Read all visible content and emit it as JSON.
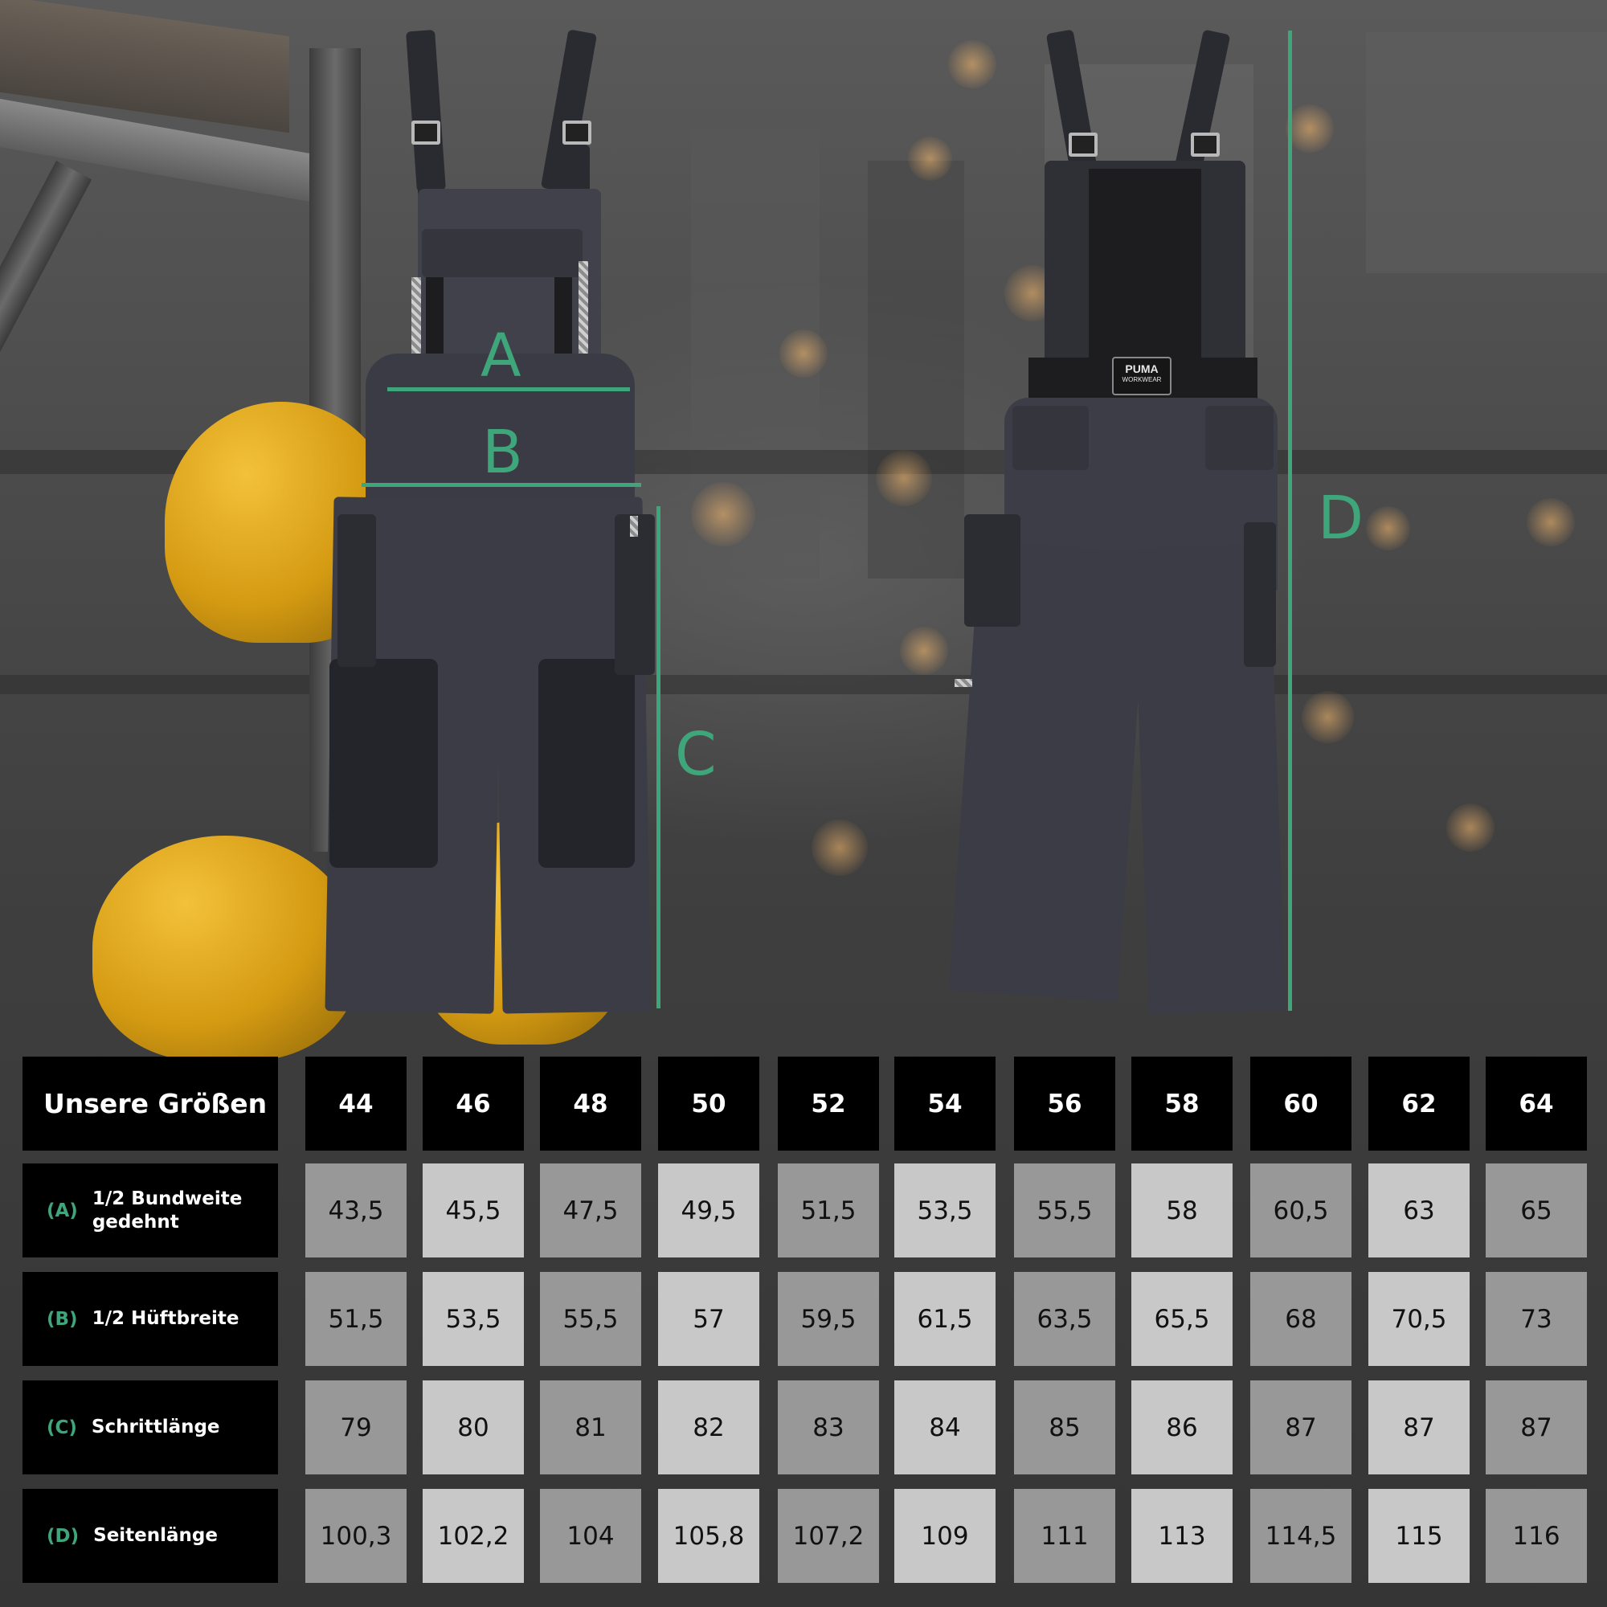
{
  "measure_letters": {
    "a": "A",
    "b": "B",
    "c": "C",
    "d": "D"
  },
  "brand_badge": {
    "line1": "PUMA",
    "line2": "WORKWEAR"
  },
  "colors": {
    "accent": "#3fa57a",
    "header_bg": "#000000",
    "cell_light": "#c8c8c8",
    "cell_dark": "#989898"
  },
  "size_table": {
    "title": "Unsere Größen",
    "sizes": [
      "44",
      "46",
      "48",
      "50",
      "52",
      "54",
      "56",
      "58",
      "60",
      "62",
      "64"
    ],
    "rows": [
      {
        "letter": "(A)",
        "label": "1/2 Bundweite gedehnt",
        "values": [
          "43,5",
          "45,5",
          "47,5",
          "49,5",
          "51,5",
          "53,5",
          "55,5",
          "58",
          "60,5",
          "63",
          "65"
        ]
      },
      {
        "letter": "(B)",
        "label": "1/2 Hüftbreite",
        "values": [
          "51,5",
          "53,5",
          "55,5",
          "57",
          "59,5",
          "61,5",
          "63,5",
          "65,5",
          "68",
          "70,5",
          "73"
        ]
      },
      {
        "letter": "(C)",
        "label": "Schrittlänge",
        "values": [
          "79",
          "80",
          "81",
          "82",
          "83",
          "84",
          "85",
          "86",
          "87",
          "87",
          "87"
        ]
      },
      {
        "letter": "(D)",
        "label": "Seitenlänge",
        "values": [
          "100,3",
          "102,2",
          "104",
          "105,8",
          "107,2",
          "109",
          "111",
          "113",
          "114,5",
          "115",
          "116"
        ]
      }
    ]
  }
}
